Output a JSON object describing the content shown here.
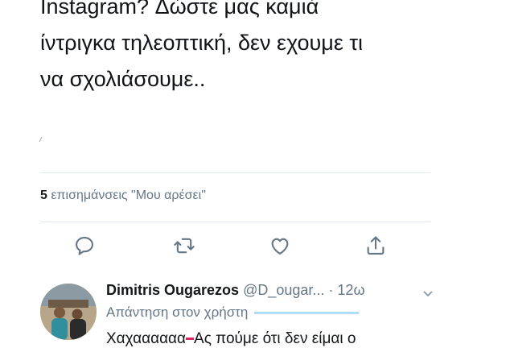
{
  "tweet": {
    "lines": [
      "Instagram?  Δώστε μας καμιά",
      "ίντριγκα τηλεοπτική, δεν εχουμε τι",
      "να σχολιάσουμε.."
    ]
  },
  "likes": {
    "count": "5",
    "label": "επισημάνσεις \"Μου αρέσει\""
  },
  "actions": {
    "reply": "reply-icon",
    "retweet": "retweet-icon",
    "like": "heart-icon",
    "share": "share-icon"
  },
  "reply_tweet": {
    "author_name": "Dimitris Ougarezos",
    "author_handle": "@D_ougar...",
    "time": "· 12ω",
    "reply_to_label": "Απάντηση στον χρήστη",
    "text_start": "Χαχαααααα",
    "text_rest": "Ας πούμε ότι δεν είμαι ο"
  },
  "colors": {
    "accent": "#1da1f2",
    "secondary_text": "#657786",
    "divider": "#e1e8ed"
  }
}
